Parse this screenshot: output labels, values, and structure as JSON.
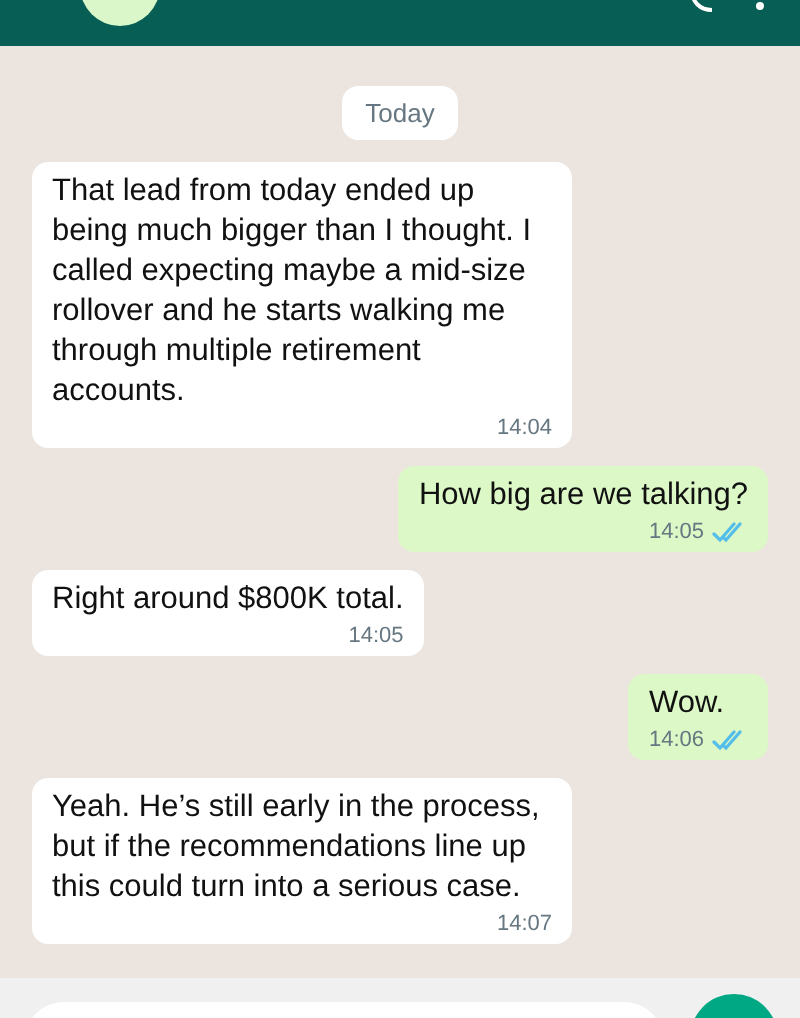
{
  "date_chip": "Today",
  "messages": [
    {
      "kind": "received",
      "text": "That lead from today ended up being much bigger than I thought. I called expecting maybe a mid-size rollover and he starts walking me through multiple retirement accounts.",
      "time": "14:04"
    },
    {
      "kind": "sent",
      "text": "How big are we talking?",
      "time": "14:05",
      "read": true
    },
    {
      "kind": "received",
      "text": "Right around $800K total.",
      "time": "14:05"
    },
    {
      "kind": "sent",
      "text": "Wow.",
      "time": "14:06",
      "read": true
    },
    {
      "kind": "received",
      "text": "Yeah. He’s still early in the process, but if the recommendations line up this could turn into a serious case.",
      "time": "14:07"
    }
  ]
}
